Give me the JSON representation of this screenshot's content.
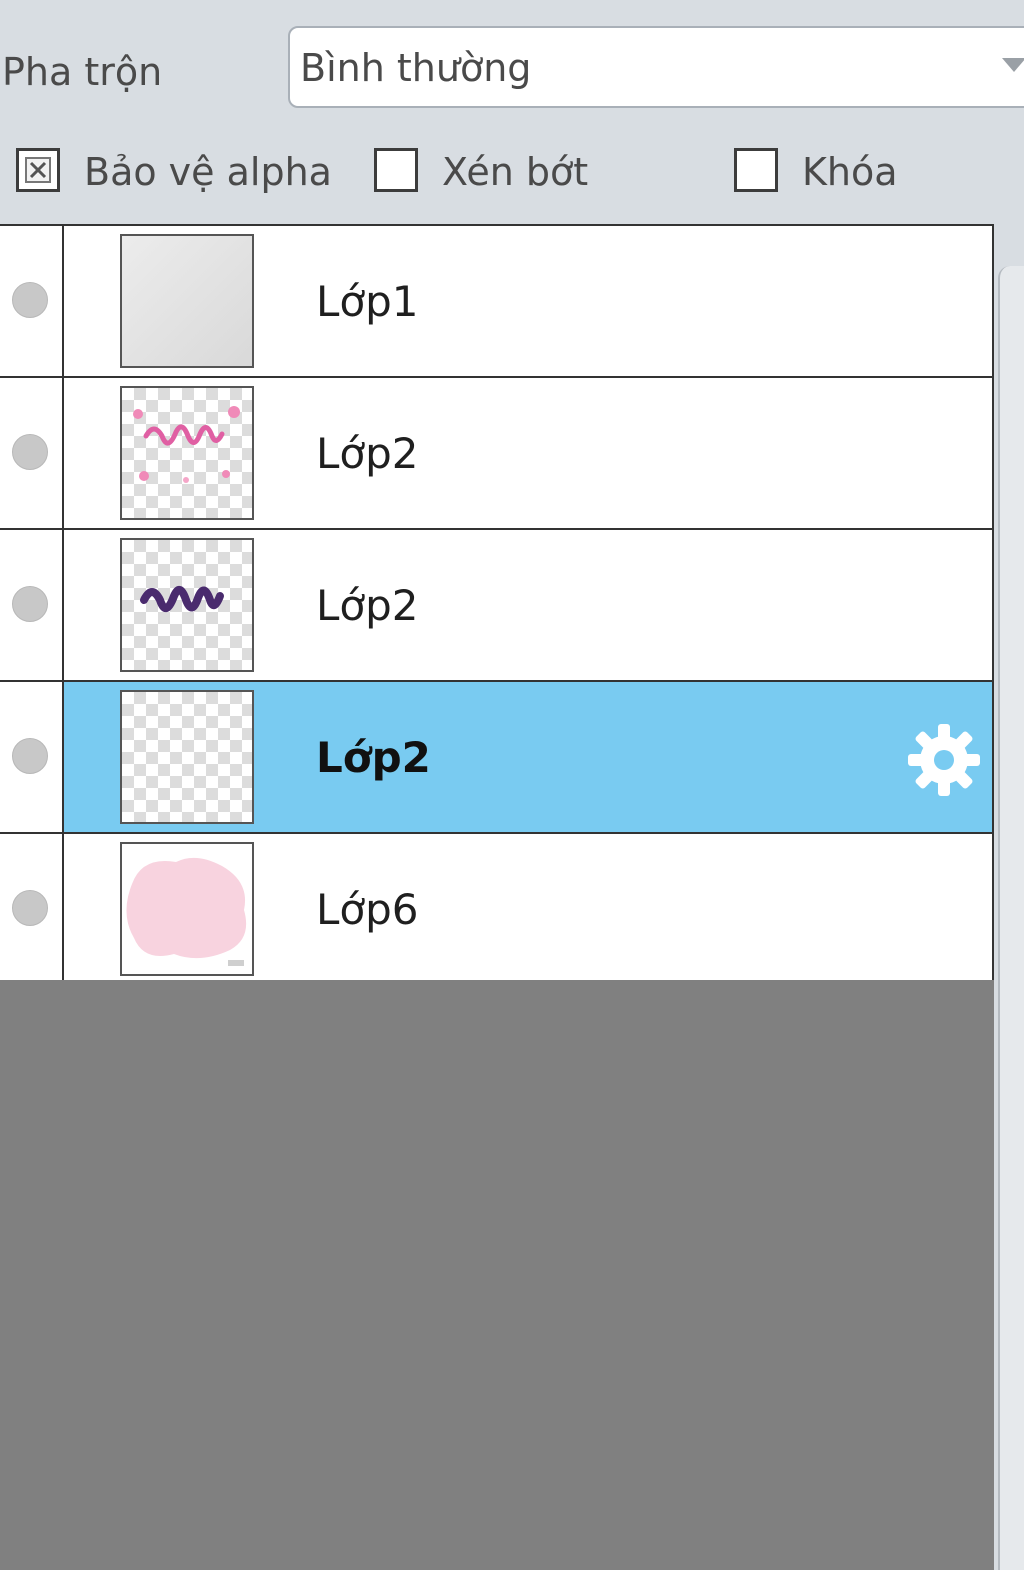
{
  "blend": {
    "label": "Pha trộn",
    "value": "Bình thường"
  },
  "options": {
    "alpha_protect": {
      "label": "Bảo vệ alpha",
      "checked": true
    },
    "clip": {
      "label": "Xén bớt",
      "checked": false
    },
    "lock": {
      "label": "Khóa",
      "checked": false
    }
  },
  "layers": [
    {
      "name": "Lớp1",
      "selected": false,
      "thumbnail": "gray-fill"
    },
    {
      "name": "Lớp2",
      "selected": false,
      "thumbnail": "pink-lettering"
    },
    {
      "name": "Lớp2",
      "selected": false,
      "thumbnail": "purple-lettering"
    },
    {
      "name": "Lớp2",
      "selected": true,
      "thumbnail": "transparent",
      "settings_icon": "gear-icon"
    },
    {
      "name": "Lớp6",
      "selected": false,
      "thumbnail": "pink-blob"
    }
  ],
  "colors": {
    "panel_bg": "#d8dde2",
    "selected_row": "#79cbf1",
    "empty_area": "#808080"
  }
}
